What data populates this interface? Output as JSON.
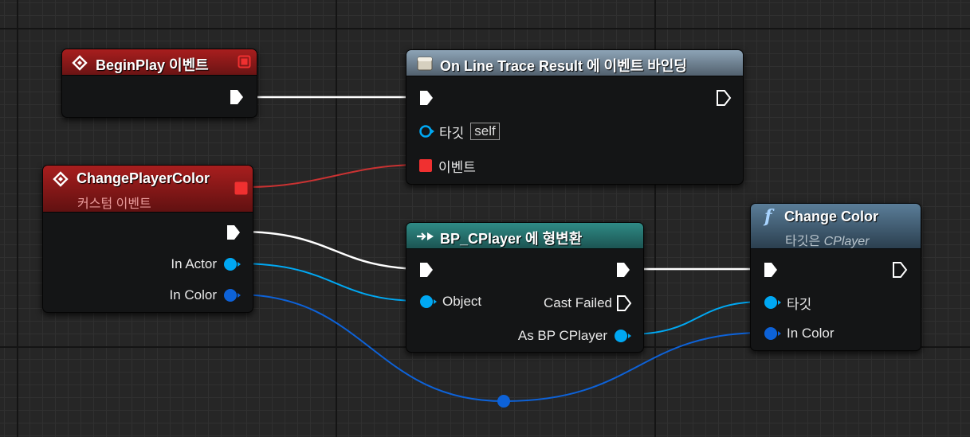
{
  "colors": {
    "exec_wire": "#ffffff",
    "delegate_wire": "#c93232",
    "object_pin": "#00a8f3",
    "color_pin": "#0d62d8",
    "delegate_pin": "#f03030"
  },
  "nodes": {
    "begin_play": {
      "icon": "event-diamond-icon",
      "title": "BeginPlay 이벤트"
    },
    "bind_event": {
      "icon": "bind-event-icon",
      "title": "On Line Trace Result 에 이벤트 바인딩",
      "target_label": "타깃",
      "target_value": "self",
      "event_label": "이벤트"
    },
    "change_player_color": {
      "icon": "event-diamond-icon",
      "title": "ChangePlayerColor",
      "subtitle": "커스텀 이벤트",
      "in_actor_label": "In Actor",
      "in_color_label": "In Color"
    },
    "cast": {
      "icon": "cast-arrow-icon",
      "title": "BP_CPlayer 에 형변환",
      "object_label": "Object",
      "cast_failed_label": "Cast Failed",
      "as_label": "As BP CPlayer"
    },
    "change_color": {
      "icon": "function-icon",
      "icon_glyph": "f",
      "title": "Change Color",
      "subtitle_prefix": "타깃은 ",
      "subtitle_class": "CPlayer",
      "target_label": "타깃",
      "in_color_label": "In Color"
    }
  }
}
